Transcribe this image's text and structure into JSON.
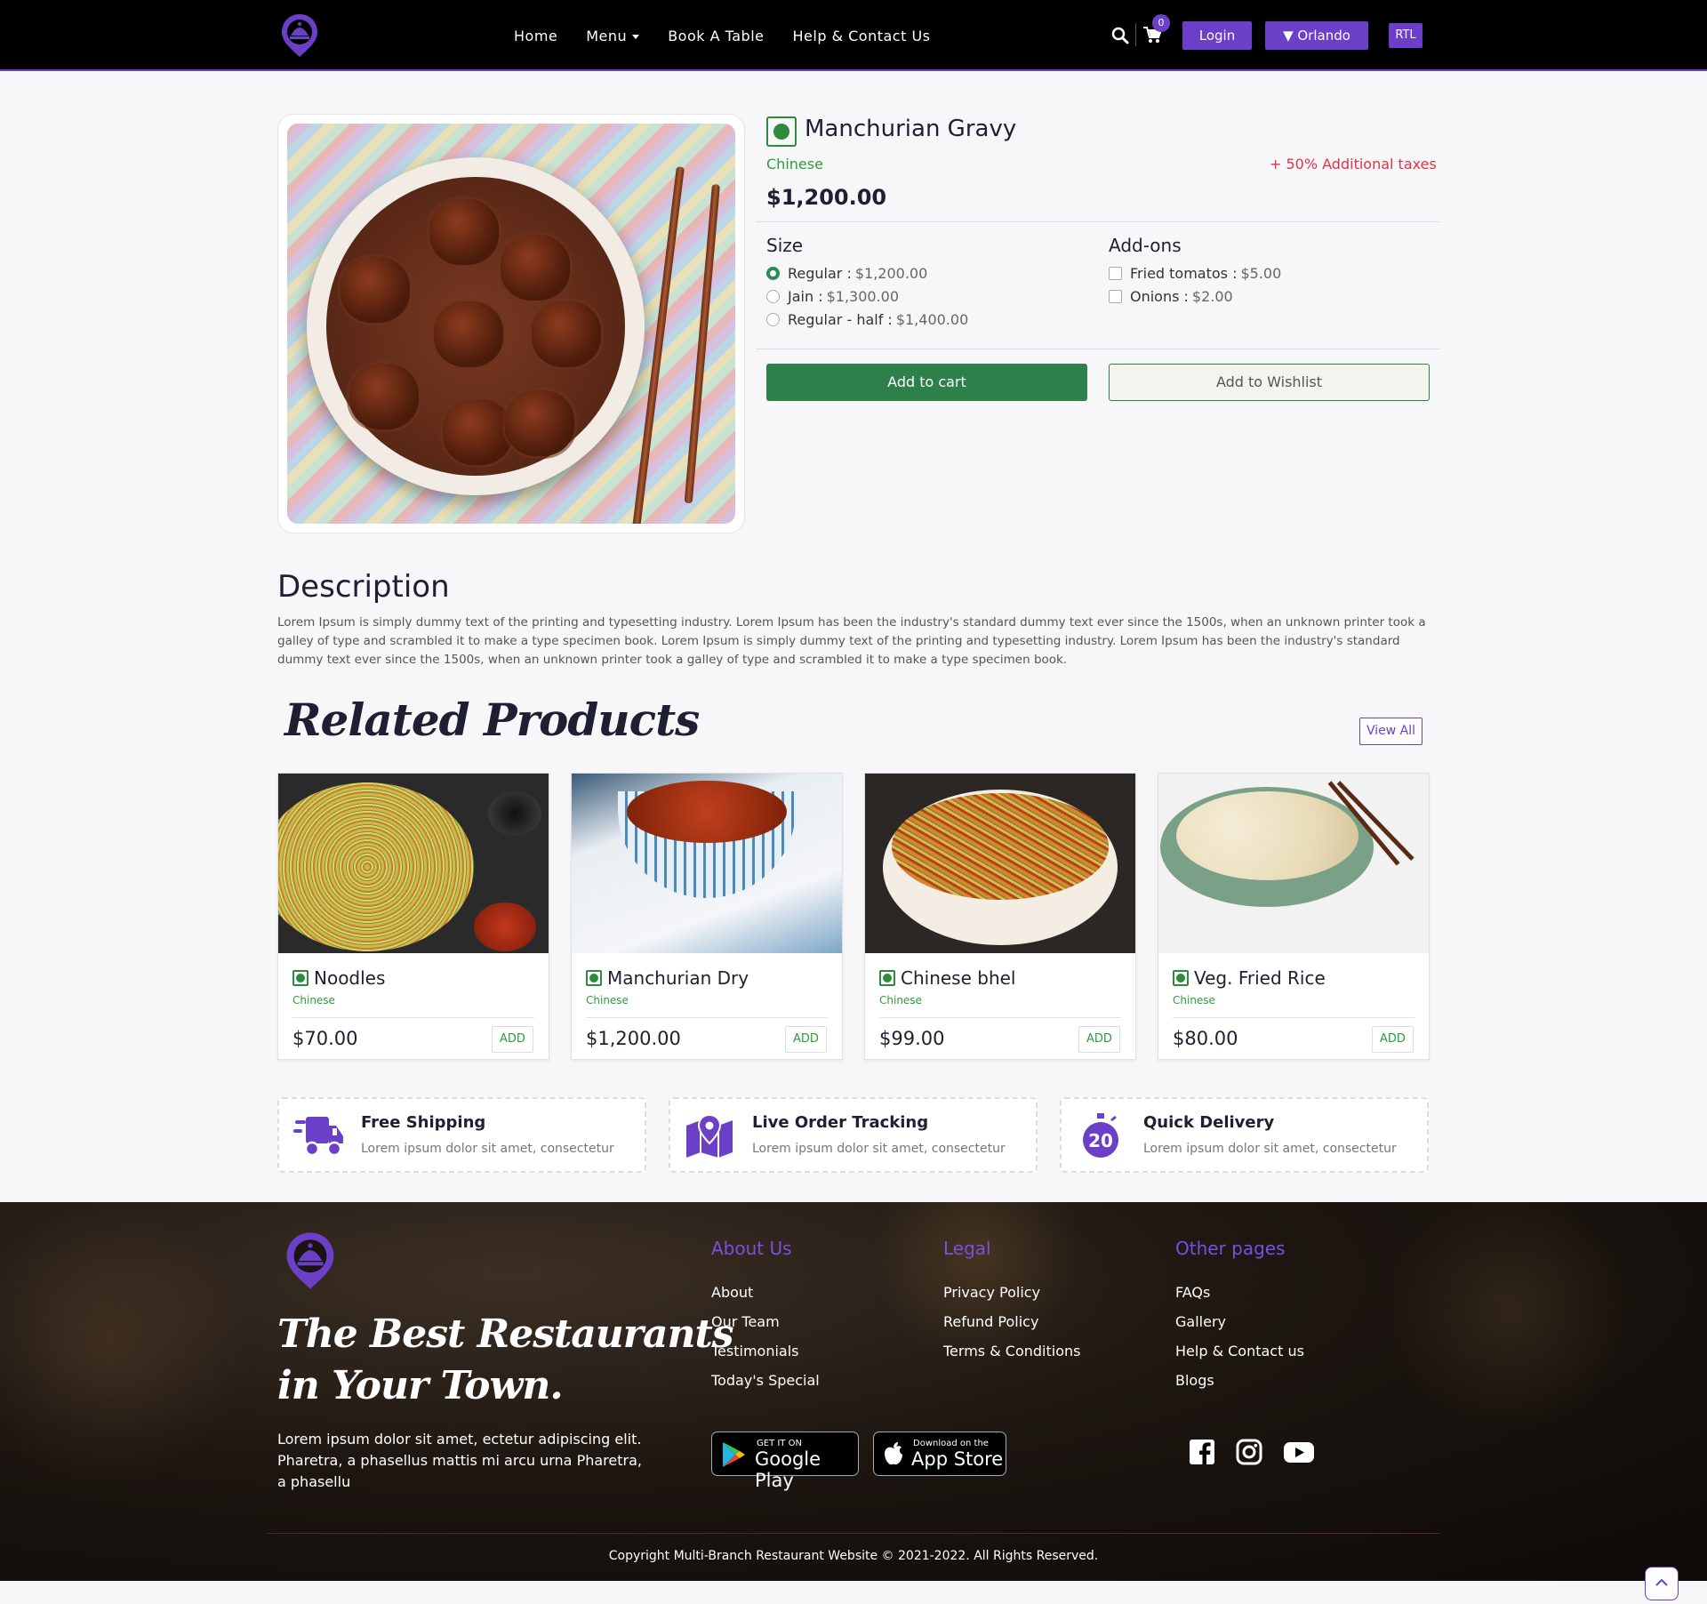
{
  "nav": {
    "links": [
      "Home",
      "Menu",
      "Book A Table",
      "Help & Contact Us"
    ],
    "cart_count": "0",
    "login": "Login",
    "location": "Orlando",
    "rtl": "RTL"
  },
  "product": {
    "title": "Manchurian Gravy",
    "category": "Chinese",
    "tax_note": "+ 50% Additional taxes",
    "price": "$1,200.00",
    "size_title": "Size",
    "sizes": [
      {
        "label": "Regular :",
        "price": "$1,200.00",
        "selected": true
      },
      {
        "label": "Jain :",
        "price": "$1,300.00",
        "selected": false
      },
      {
        "label": "Regular - half :",
        "price": "$1,400.00",
        "selected": false
      }
    ],
    "addons_title": "Add-ons",
    "addons": [
      {
        "label": "Fried tomatos :",
        "price": "$5.00"
      },
      {
        "label": "Onions :",
        "price": "$2.00"
      }
    ],
    "add_to_cart": "Add to cart",
    "add_to_wishlist": "Add to Wishlist"
  },
  "description": {
    "heading": "Description",
    "text": "Lorem Ipsum is simply dummy text of the printing and typesetting industry. Lorem Ipsum has been the industry's standard dummy text ever since the 1500s, when an unknown printer took a galley of type and scrambled it to make a type specimen book. Lorem Ipsum is simply dummy text of the printing and typesetting industry. Lorem Ipsum has been the industry's standard dummy text ever since the 1500s, when an unknown printer took a galley of type and scrambled it to make a type specimen book."
  },
  "related": {
    "heading": "Related Products",
    "view_all": "View All",
    "items": [
      {
        "name": "Noodles",
        "category": "Chinese",
        "price": "$70.00",
        "add": "ADD"
      },
      {
        "name": "Manchurian Dry",
        "category": "Chinese",
        "price": "$1,200.00",
        "add": "ADD"
      },
      {
        "name": "Chinese bhel",
        "category": "Chinese",
        "price": "$99.00",
        "add": "ADD"
      },
      {
        "name": "Veg. Fried Rice",
        "category": "Chinese",
        "price": "$80.00",
        "add": "ADD"
      }
    ]
  },
  "features": [
    {
      "title": "Free Shipping",
      "text": "Lorem ipsum dolor sit amet, consectetur",
      "icon": "truck-icon"
    },
    {
      "title": "Live Order Tracking",
      "text": "Lorem ipsum dolor sit amet, consectetur",
      "icon": "map-pin-icon"
    },
    {
      "title": "Quick Delivery",
      "text": "Lorem ipsum dolor sit amet, consectetur",
      "icon": "stopwatch-icon",
      "badge": "20"
    }
  ],
  "footer": {
    "tagline_line1": "The Best Restaurants",
    "tagline_line2": "in Your Town.",
    "about": "Lorem ipsum dolor sit amet, ectetur adipiscing elit. Pharetra, a phasellus mattis mi arcu urna Pharetra, a phasellu",
    "columns": [
      {
        "title": "About Us",
        "links": [
          "About",
          "Our Team",
          "Testimonials",
          "Today's Special"
        ]
      },
      {
        "title": "Legal",
        "links": [
          "Privacy Policy",
          "Refund Policy",
          "Terms & Conditions"
        ]
      },
      {
        "title": "Other pages",
        "links": [
          "FAQs",
          "Gallery",
          "Help & Contact us",
          "Blogs"
        ]
      }
    ],
    "google_play_small": "GET IT ON",
    "google_play_big": "Google Play",
    "app_store_small": "Download on the",
    "app_store_big": "App Store",
    "copyright": "Copyright Multi-Branch Restaurant Website © 2021-2022. All Rights Reserved."
  },
  "colors": {
    "primary": "#6b3fc8",
    "green": "#2d8049",
    "veg": "#2e8b3e",
    "tax": "#e0324a"
  }
}
